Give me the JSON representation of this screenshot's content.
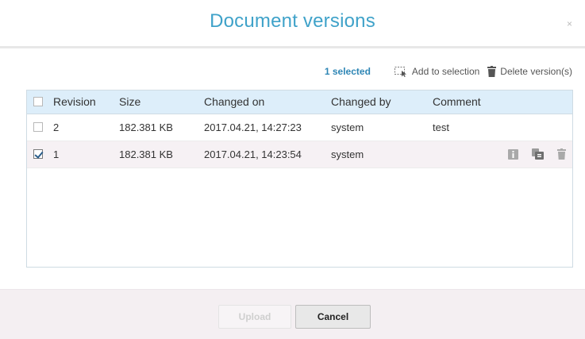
{
  "dialog": {
    "title": "Document versions",
    "close_label": "×"
  },
  "toolbar": {
    "selected_count": "1 selected",
    "add_to_selection": "Add to selection",
    "delete_versions": "Delete version(s)"
  },
  "grid": {
    "columns": [
      "Revision",
      "Size",
      "Changed on",
      "Changed by",
      "Comment"
    ],
    "rows": [
      {
        "revision": "2",
        "size": "182.381 KB",
        "changed_on": "2017.04.21, 14:27:23",
        "changed_by": "system",
        "comment": "test",
        "checked": false
      },
      {
        "revision": "1",
        "size": "182.381 KB",
        "changed_on": "2017.04.21, 14:23:54",
        "changed_by": "system",
        "comment": "",
        "checked": true
      }
    ]
  },
  "footer": {
    "upload_label": "Upload",
    "cancel_label": "Cancel"
  },
  "colors": {
    "title": "#3fa2c9",
    "selected_count": "#2e86b5",
    "header_bg": "#ddeefa",
    "selected_row_bg": "#f6f1f4",
    "footer_bg": "#f4eff2"
  }
}
